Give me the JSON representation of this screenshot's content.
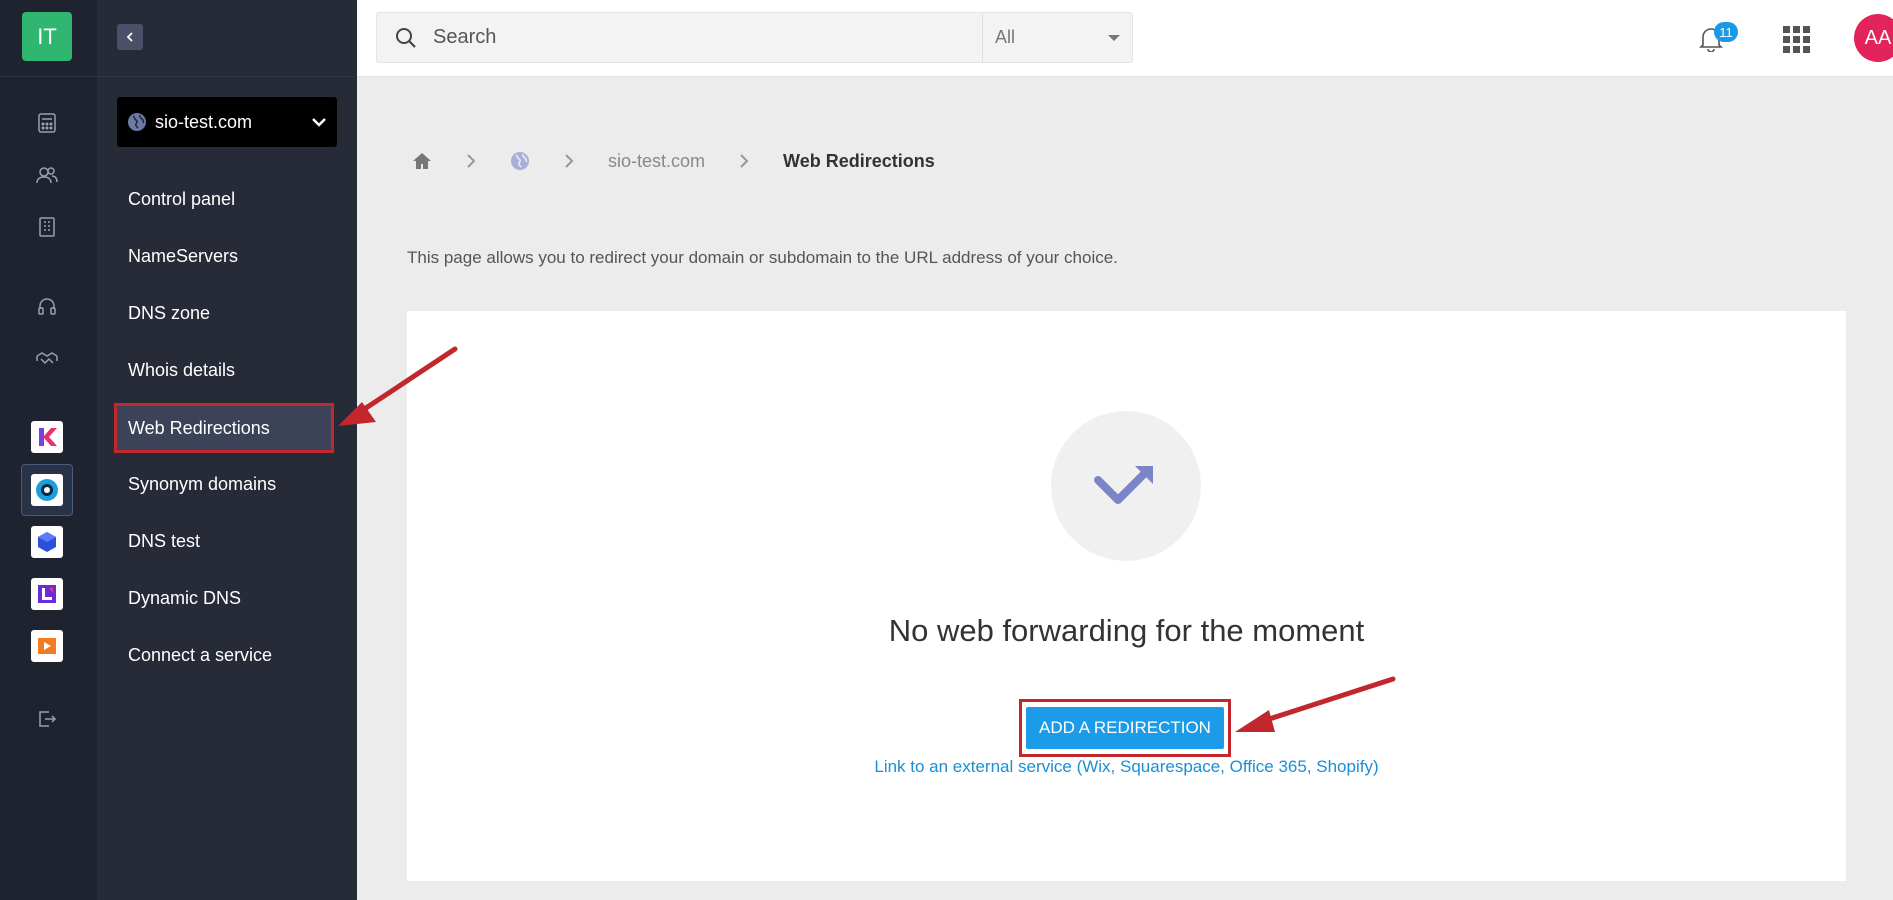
{
  "rail": {
    "logo_text": "IT"
  },
  "menu": {
    "domain": "sio-test.com",
    "items": [
      {
        "label": "Control panel"
      },
      {
        "label": "NameServers"
      },
      {
        "label": "DNS zone"
      },
      {
        "label": "Whois details"
      },
      {
        "label": "Web Redirections",
        "active": true
      },
      {
        "label": "Synonym domains"
      },
      {
        "label": "DNS test"
      },
      {
        "label": "Dynamic DNS"
      },
      {
        "label": "Connect a service"
      }
    ]
  },
  "topbar": {
    "search_placeholder": "Search",
    "scope": "All",
    "notification_count": "11",
    "avatar_initials": "AA"
  },
  "breadcrumb": {
    "domain": "sio-test.com",
    "current": "Web Redirections"
  },
  "content": {
    "intro": "This page allows you to redirect your domain or subdomain to the URL address of your choice.",
    "empty_title": "No web forwarding for the moment",
    "add_button": "ADD A REDIRECTION",
    "external_link": "Link to an external service (Wix, Squarespace, Office 365, Shopify)"
  },
  "colors": {
    "rail_bg": "#1f2330",
    "menu_bg": "#272b38",
    "logo": "#2fb772",
    "accent": "#1c9be8",
    "highlight": "#c1272d",
    "avatar": "#e3245c"
  }
}
